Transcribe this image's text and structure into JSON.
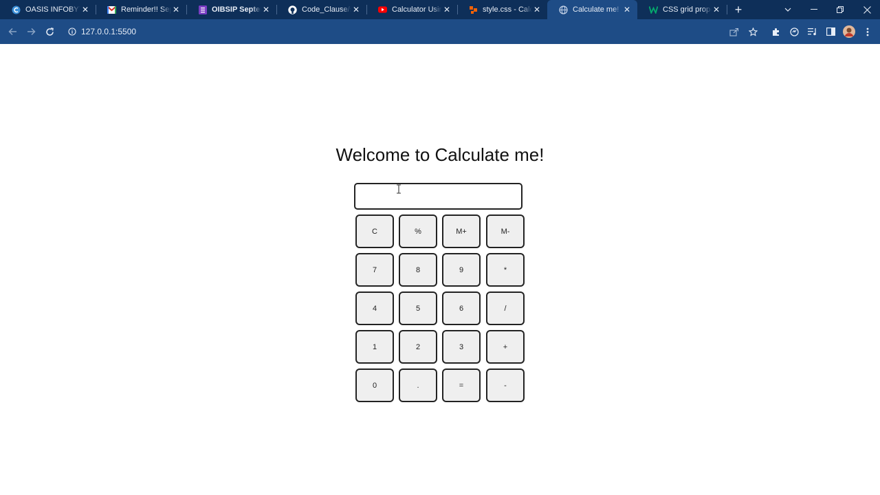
{
  "browser": {
    "tabs": [
      {
        "title": "OASIS INFOBYTE",
        "icon": "oasis-logo-icon"
      },
      {
        "title": "Reminder!! Septe",
        "icon": "gmail-icon"
      },
      {
        "title": "OIBSIP Septemb",
        "icon": "forms-icon"
      },
      {
        "title": "Code_Clause/src",
        "icon": "github-icon"
      },
      {
        "title": "Calculator Using",
        "icon": "youtube-icon"
      },
      {
        "title": "style.css - Calcul",
        "icon": "code-editor-icon"
      },
      {
        "title": "Calculate me! - ",
        "icon": "globe-icon"
      },
      {
        "title": "CSS grid propert",
        "icon": "w3schools-icon"
      }
    ],
    "active_tab": 6,
    "url": "127.0.0.1:5500"
  },
  "page": {
    "heading": "Welcome to Calculate me!",
    "display_value": "",
    "keys": [
      [
        "C",
        "%",
        "M+",
        "M-"
      ],
      [
        "7",
        "8",
        "9",
        "*"
      ],
      [
        "4",
        "5",
        "6",
        "/"
      ],
      [
        "1",
        "2",
        "3",
        "+"
      ],
      [
        "0",
        ".",
        "=",
        "-"
      ]
    ]
  },
  "colors": {
    "tabstrip": "#0e2f59",
    "toolbar": "#1e4c86",
    "key_background": "#efefef",
    "key_border": "#222222"
  }
}
